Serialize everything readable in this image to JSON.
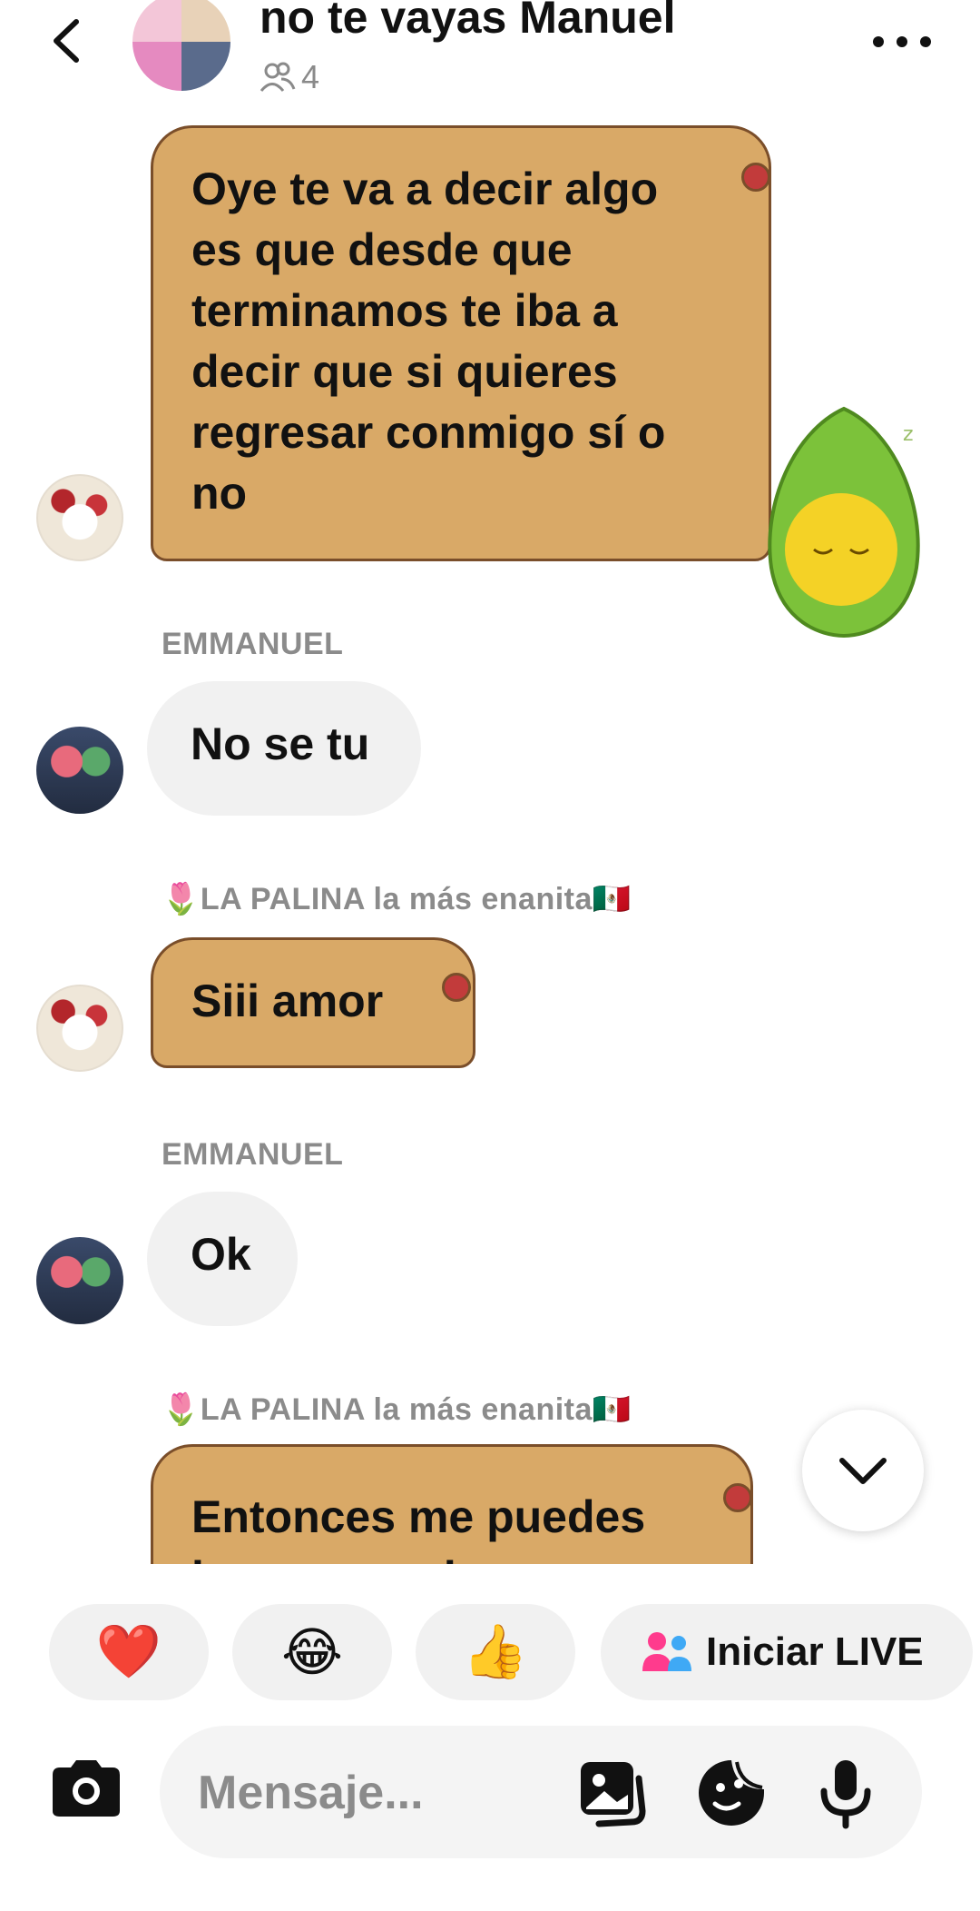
{
  "header": {
    "title": "no te vayas Manuel",
    "member_count": "4",
    "back_icon": "chevron-left-icon",
    "members_icon": "people-icon",
    "more_icon": "more-horizontal-icon"
  },
  "messages": [
    {
      "sender": "",
      "type": "sticker-bubble",
      "text": "Oye te va a decir algo es que desde que terminamos te iba a decir que si quieres regresar conmigo sí o no"
    },
    {
      "sender": "EMMANUEL",
      "type": "bubble",
      "text": "No se tu"
    },
    {
      "sender": "🌷LA PALINA la más enanita🇲🇽",
      "type": "sticker-bubble",
      "text": "Siii amor"
    },
    {
      "sender": "EMMANUEL",
      "type": "bubble",
      "text": "Ok"
    },
    {
      "sender": "🌷LA PALINA la más enanita🇲🇽",
      "type": "sticker-bubble",
      "text": "Entonces me puedes buscar y volverme"
    }
  ],
  "quick_reactions": [
    "❤️",
    "😂",
    "👍"
  ],
  "live_button": {
    "label": "Iniciar LIVE",
    "icon": "people-icon"
  },
  "composer": {
    "placeholder": "Mensaje...",
    "camera_icon": "camera-icon",
    "gallery_icon": "gallery-icon",
    "sticker_icon": "sticker-icon",
    "mic_icon": "microphone-icon"
  },
  "colors": {
    "bubble_brown": "#d9a967",
    "bubble_gray": "#f1f1f1",
    "sender_gray": "#8b8b8b"
  }
}
